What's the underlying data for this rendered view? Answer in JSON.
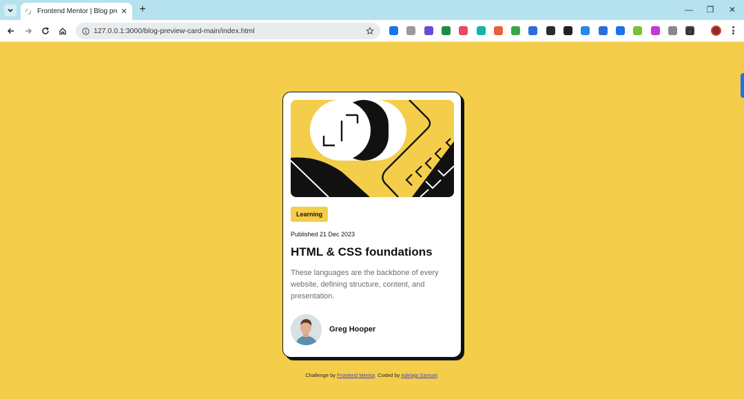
{
  "browser": {
    "tab_title": "Frontend Mentor | Blog preview card",
    "tab_close": "✕",
    "new_tab": "+",
    "url": "127.0.0.1:3000/blog-preview-card-main/index.html",
    "window_controls": {
      "minimize": "—",
      "maximize": "❐",
      "close": "✕"
    },
    "extension_icons": [
      "#1a73e8",
      "#999999",
      "#6a4ad8",
      "#1c8a4a",
      "#e84a5f",
      "#16b3a6",
      "#e8603c",
      "#3aa64a",
      "#2a6fd8",
      "#2b2b33",
      "#222222",
      "#2a8ae0",
      "#2a6fd8",
      "#1a73e8",
      "#7cbf3a",
      "#c33ad8",
      "#888888",
      "#444444"
    ]
  },
  "card": {
    "tag": "Learning",
    "published": "Published 21 Dec 2023",
    "title": "HTML & CSS foundations",
    "description": "These languages are the backbone of every website, defining structure, content, and presentation.",
    "author": "Greg Hooper"
  },
  "attribution": {
    "prefix": "Challenge by",
    "link1": "Frontend Mentor",
    "middle": ". Coded by",
    "link2": "Adelaja Samuel",
    "suffix": "."
  },
  "colors": {
    "background": "#f4ce4a",
    "accent": "#f4ce4a",
    "ink": "#111111"
  }
}
